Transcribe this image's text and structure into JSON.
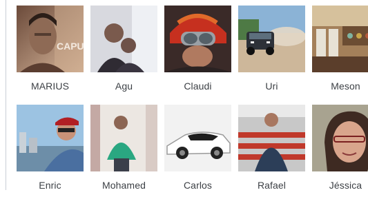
{
  "friends": [
    {
      "name": "MARIUS",
      "thumb_icon": "person-photo",
      "overlay_text": "CAPU"
    },
    {
      "name": "Agu",
      "thumb_icon": "person-photo"
    },
    {
      "name": "Claudi",
      "thumb_icon": "person-photo"
    },
    {
      "name": "Uri",
      "thumb_icon": "car-photo"
    },
    {
      "name": "Meson",
      "thumb_icon": "storefront-photo"
    },
    {
      "name": "Enric",
      "thumb_icon": "person-photo"
    },
    {
      "name": "Mohamed",
      "thumb_icon": "person-photo"
    },
    {
      "name": "Carlos",
      "thumb_icon": "car-photo"
    },
    {
      "name": "Rafael",
      "thumb_icon": "person-photo"
    },
    {
      "name": "Jéssica",
      "thumb_icon": "person-photo"
    }
  ]
}
